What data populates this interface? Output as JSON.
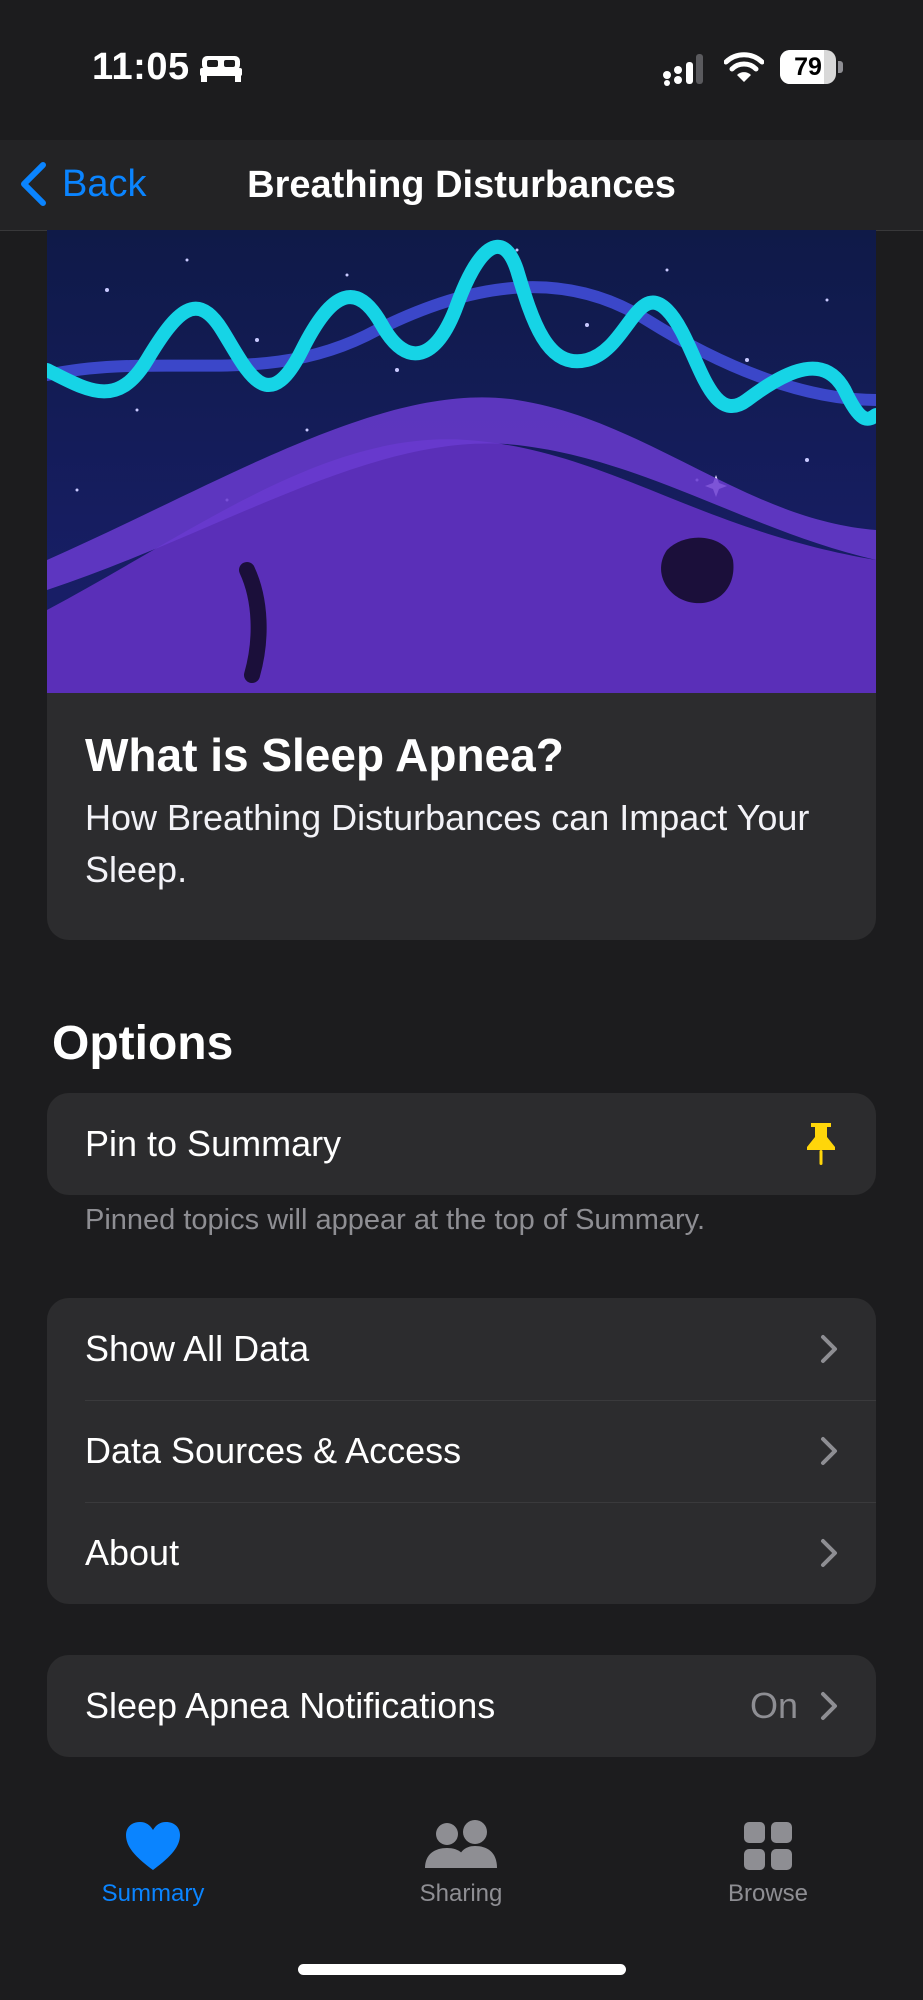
{
  "status_bar": {
    "time": "11:05",
    "battery": "79",
    "battery_level": 0.79
  },
  "nav": {
    "back_label": "Back",
    "title": "Breathing Disturbances"
  },
  "hero": {
    "title": "What is Sleep Apnea?",
    "subtitle": "How Breathing Disturbances can Impact Your Sleep."
  },
  "options": {
    "title": "Options",
    "pin": {
      "label": "Pin to Summary",
      "icon": "pin-icon",
      "icon_color": "#ffd60a"
    },
    "footnote": "Pinned topics will appear at the top of Summary.",
    "rows": [
      {
        "label": "Show All Data"
      },
      {
        "label": "Data Sources & Access"
      },
      {
        "label": "About"
      }
    ],
    "notifications": {
      "label": "Sleep Apnea Notifications",
      "value": "On"
    }
  },
  "tabs": [
    {
      "label": "Summary",
      "icon": "heart-icon",
      "active": true
    },
    {
      "label": "Sharing",
      "icon": "people-icon",
      "active": false
    },
    {
      "label": "Browse",
      "icon": "grid-icon",
      "active": false
    }
  ],
  "colors": {
    "accent": "#0a84ff",
    "background": "#1c1c1e",
    "card": "#2c2c2e",
    "inactive": "#8e8e93"
  }
}
